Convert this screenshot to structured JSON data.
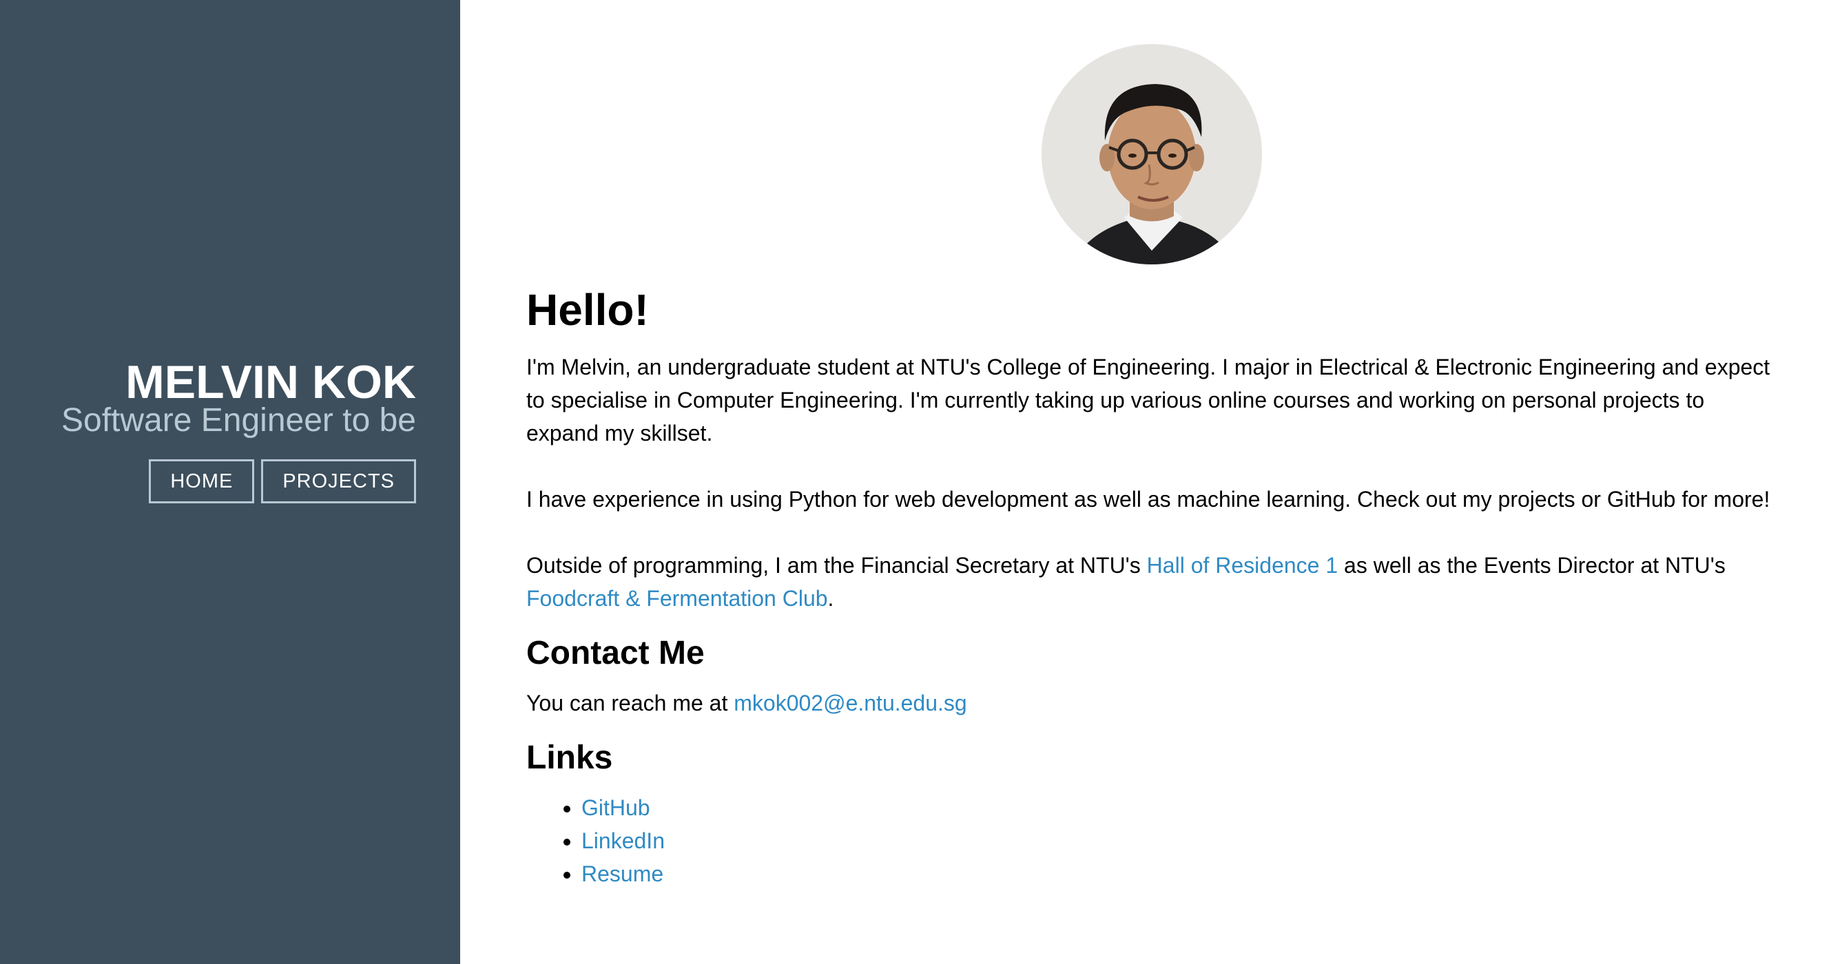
{
  "sidebar": {
    "name": "MELVIN KOK",
    "tagline": "Software Engineer to be",
    "nav": [
      {
        "label": "HOME"
      },
      {
        "label": "PROJECTS"
      }
    ]
  },
  "main": {
    "hello_heading": "Hello!",
    "intro": {
      "p1": "I'm Melvin, an undergraduate student at NTU's College of Engineering. I major in Electrical & Electronic Engineering and expect to specialise in Computer Engineering. I'm currently taking up various online courses and working on personal projects to expand my skillset.",
      "p2": "I have experience in using Python for web development as well as machine learning. Check out my projects or GitHub for more!",
      "p3_before": "Outside of programming, I am the Financial Secretary at NTU's ",
      "p3_link1": "Hall of Residence 1",
      "p3_middle": " as well as the Events Director at NTU's ",
      "p3_link2": "Foodcraft & Fermentation Club",
      "p3_after": "."
    },
    "contact": {
      "heading": "Contact Me",
      "text": "You can reach me at ",
      "email": "mkok002@e.ntu.edu.sg"
    },
    "links": {
      "heading": "Links",
      "items": [
        {
          "label": "GitHub"
        },
        {
          "label": "LinkedIn"
        },
        {
          "label": "Resume"
        }
      ]
    }
  },
  "colors": {
    "sidebar_bg": "#3d4f5d",
    "link": "#2f8ac4",
    "tagline": "#b9c8d3"
  }
}
